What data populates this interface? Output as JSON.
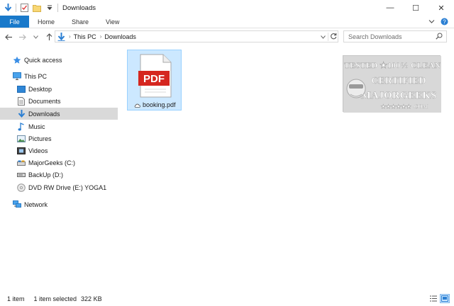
{
  "window": {
    "title": "Downloads",
    "minimize_glyph": "—",
    "maximize_glyph": "☐",
    "close_glyph": "✕"
  },
  "ribbon": {
    "tabs": [
      {
        "label": "File",
        "active": true
      },
      {
        "label": "Home"
      },
      {
        "label": "Share"
      },
      {
        "label": "View"
      }
    ],
    "accent": "#1979ca"
  },
  "address": {
    "breadcrumbs": [
      "This PC",
      "Downloads"
    ],
    "search_placeholder": "Search Downloads"
  },
  "navigation": {
    "items": [
      {
        "label": "Quick access",
        "icon": "star-icon",
        "level": 0
      },
      {
        "label": "This PC",
        "icon": "computer-icon",
        "level": 0
      },
      {
        "label": "Desktop",
        "icon": "desktop-folder-icon",
        "level": 1
      },
      {
        "label": "Documents",
        "icon": "documents-folder-icon",
        "level": 1
      },
      {
        "label": "Downloads",
        "icon": "downloads-folder-icon",
        "level": 1,
        "selected": true
      },
      {
        "label": "Music",
        "icon": "music-folder-icon",
        "level": 1
      },
      {
        "label": "Pictures",
        "icon": "pictures-folder-icon",
        "level": 1
      },
      {
        "label": "Videos",
        "icon": "videos-folder-icon",
        "level": 1
      },
      {
        "label": "MajorGeeks (C:)",
        "icon": "drive-icon",
        "level": 1
      },
      {
        "label": "BackUp (D:)",
        "icon": "drive-icon",
        "level": 1
      },
      {
        "label": "DVD RW Drive (E:) YOGA1",
        "icon": "dvd-drive-icon",
        "level": 1
      },
      {
        "label": "Network",
        "icon": "network-icon",
        "level": 0
      }
    ]
  },
  "content": {
    "files": [
      {
        "name": "booking.pdf",
        "icon": "pdf-file-icon",
        "badge": "PDF",
        "selected": true
      }
    ],
    "watermark": {
      "line1": "TESTED ★100% CLEAN",
      "line2": "CERTIFIED",
      "line3": "MAJORGEEKS",
      "line4": "★★★★★★ .COM"
    }
  },
  "status": {
    "item_count": "1 item",
    "selection": "1 item selected",
    "size": "322 KB"
  }
}
